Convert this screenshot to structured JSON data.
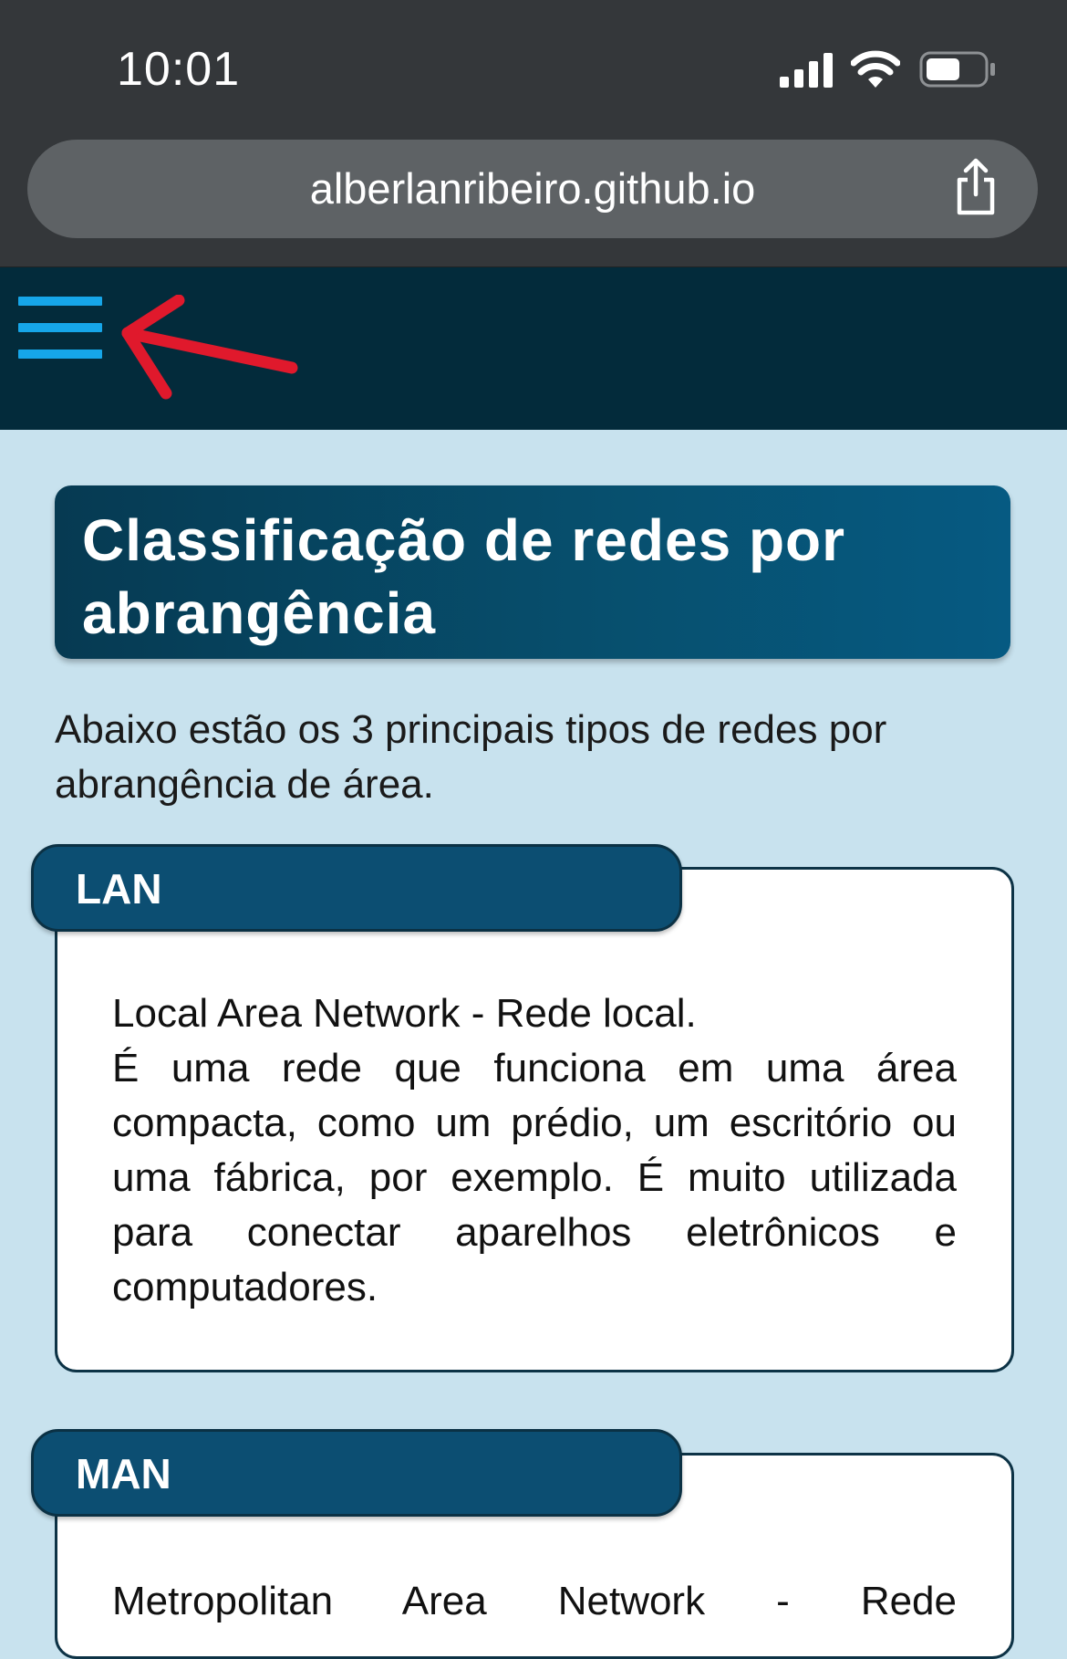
{
  "status_bar": {
    "time": "10:01"
  },
  "browser": {
    "url": "alberlanribeiro.github.io"
  },
  "page": {
    "title": "Classificação de redes por abrangência",
    "intro": "Abaixo estão os 3 principais tipos de redes por abrangência de área.",
    "cards": [
      {
        "label": "LAN",
        "line1": "Local Area Network - Rede local.",
        "body": "É uma rede que funciona em uma área compacta, como um prédio, um escritório ou uma fábrica, por exemplo. É muito utilizada para conectar aparelhos eletrônicos e computadores."
      },
      {
        "label": "MAN",
        "line1": "Metropolitan Area Network - Rede"
      }
    ]
  },
  "colors": {
    "status_bar": "#34373a",
    "nav_bg": "#032b3b",
    "hamburger": "#16a6e9",
    "page_bg": "#c8e2ee",
    "title_box": "#07506f",
    "card_tab": "#0c4e72",
    "annotation_arrow": "#e0192c"
  },
  "icons": {
    "menu": "hamburger-menu-icon",
    "annotation": "red-arrow-icon",
    "share": "share-icon",
    "signal": "cellular-signal-icon",
    "wifi": "wifi-icon",
    "battery": "battery-icon"
  }
}
